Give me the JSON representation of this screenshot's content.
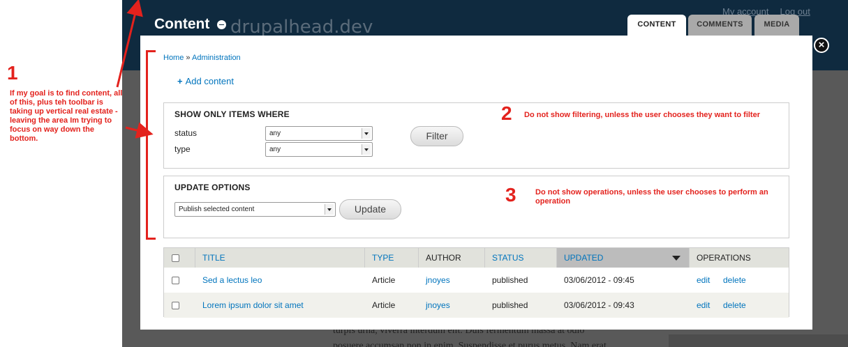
{
  "site": {
    "logo_text": "drupalhead.dev",
    "links": [
      "My account",
      "Log out"
    ],
    "page_title": "Content",
    "tabs": [
      {
        "label": "CONTENT",
        "active": true
      },
      {
        "label": "COMMENTS",
        "active": false
      },
      {
        "label": "MEDIA",
        "active": false
      }
    ],
    "bg_text": [
      "turpis urna, viverra interdum elit. Duis fermentum massa at odio",
      "posuere accumsan non in enim. Suspendisse et purus metus. Nam erat"
    ]
  },
  "overlay": {
    "breadcrumb": {
      "home": "Home",
      "separator": "»",
      "current": "Administration"
    },
    "add_content": "Add content",
    "filter": {
      "legend": "SHOW ONLY ITEMS WHERE",
      "status_label": "status",
      "status_value": "any",
      "type_label": "type",
      "type_value": "any",
      "button": "Filter"
    },
    "update": {
      "legend": "UPDATE OPTIONS",
      "select_value": "Publish selected content",
      "button": "Update"
    },
    "table": {
      "headers": [
        "TITLE",
        "TYPE",
        "AUTHOR",
        "STATUS",
        "UPDATED",
        "OPERATIONS"
      ],
      "rows": [
        {
          "title": "Sed a lectus leo",
          "type": "Article",
          "author": "jnoyes",
          "status": "published",
          "updated": "03/06/2012 - 09:45",
          "edit": "edit",
          "delete": "delete"
        },
        {
          "title": "Lorem ipsum dolor sit amet",
          "type": "Article",
          "author": "jnoyes",
          "status": "published",
          "updated": "03/06/2012 - 09:43",
          "edit": "edit",
          "delete": "delete"
        }
      ]
    }
  },
  "annotations": {
    "one": {
      "number": "1",
      "text": "If my goal is to find content, all of this, plus teh toolbar is taking up vertical real estate - leaving the area Im trying to focus on way down the bottom."
    },
    "two": {
      "number": "2",
      "text": "Do not show filtering, unless the user chooses they want to filter"
    },
    "three": {
      "number": "3",
      "text": "Do not show operations, unless the user chooses to perform an operation"
    }
  },
  "colors": {
    "accent": "#e3221d",
    "link": "#0074bd",
    "header": "#0f2a3f"
  }
}
